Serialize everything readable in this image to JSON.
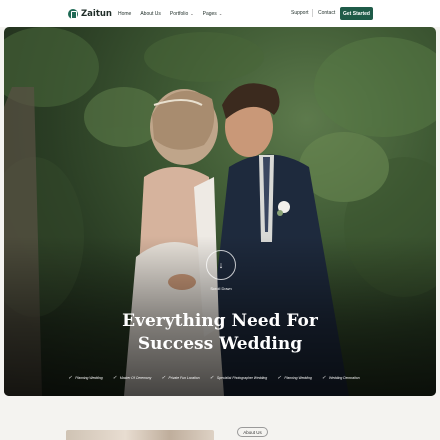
{
  "brand": {
    "name": "Zaitun"
  },
  "nav": {
    "links": [
      {
        "label": "Home",
        "dropdown": false
      },
      {
        "label": "About Us",
        "dropdown": false
      },
      {
        "label": "Portfolio",
        "dropdown": true
      },
      {
        "label": "Pages",
        "dropdown": true
      }
    ],
    "support": "Support",
    "contact": "Contact",
    "cta": "Get Started"
  },
  "hero": {
    "scroll_icon": "arrow-down-icon",
    "scroll_label": "Scroll Down",
    "headline_line1": "Everything Need For",
    "headline_line2": "Success Wedding",
    "features": [
      "Planning Wedding",
      "Master Of Ceremony",
      "Private Fun Location",
      "Specialist Photographer Wedding",
      "Planning Wedding",
      "Wedding Decoration"
    ]
  },
  "about": {
    "badge": "About Us"
  },
  "colors": {
    "brand_green": "#1f5b48",
    "hero_foliage": "#3f5a34",
    "background": "#f4f3f0"
  }
}
